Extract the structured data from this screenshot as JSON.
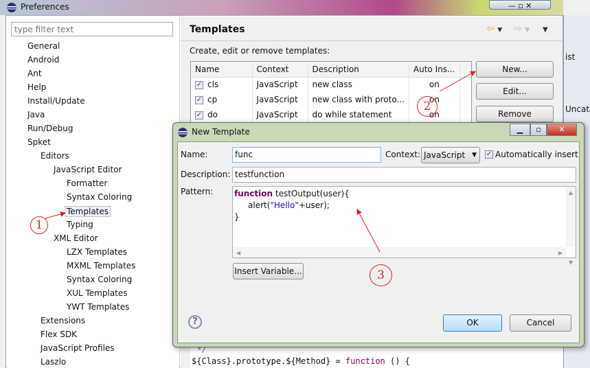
{
  "window": {
    "title": "Preferences"
  },
  "filter": {
    "placeholder": "type filter text"
  },
  "tree": [
    {
      "label": "General",
      "level": 1
    },
    {
      "label": "Android",
      "level": 1
    },
    {
      "label": "Ant",
      "level": 1
    },
    {
      "label": "Help",
      "level": 1
    },
    {
      "label": "Install/Update",
      "level": 1
    },
    {
      "label": "Java",
      "level": 1
    },
    {
      "label": "Run/Debug",
      "level": 1
    },
    {
      "label": "Spket",
      "level": 1
    },
    {
      "label": "Editors",
      "level": 2
    },
    {
      "label": "JavaScript Editor",
      "level": 3
    },
    {
      "label": "Formatter",
      "level": 4
    },
    {
      "label": "Syntax Coloring",
      "level": 4
    },
    {
      "label": "Templates",
      "level": 4,
      "selected": true
    },
    {
      "label": "Typing",
      "level": 4
    },
    {
      "label": "XML Editor",
      "level": 3
    },
    {
      "label": "LZX Templates",
      "level": 4
    },
    {
      "label": "MXML Templates",
      "level": 4
    },
    {
      "label": "Syntax Coloring",
      "level": 4
    },
    {
      "label": "XUL Templates",
      "level": 4
    },
    {
      "label": "YWT Templates",
      "level": 4
    },
    {
      "label": "Extensions",
      "level": 2
    },
    {
      "label": "Flex SDK",
      "level": 2
    },
    {
      "label": "JavaScript Profiles",
      "level": 2
    },
    {
      "label": "Laszlo",
      "level": 2
    }
  ],
  "page": {
    "title": "Templates",
    "description": "Create, edit or remove templates:",
    "columns": [
      "Name",
      "Context",
      "Description",
      "Auto Ins..."
    ],
    "rows": [
      {
        "checked": true,
        "name": "cls",
        "context": "JavaScript",
        "description": "new class",
        "auto": "on"
      },
      {
        "checked": true,
        "name": "cp",
        "context": "JavaScript",
        "description": "new class with proto...",
        "auto": "on"
      },
      {
        "checked": true,
        "name": "do",
        "context": "JavaScript",
        "description": "do while statement",
        "auto": "on"
      }
    ],
    "buttons": {
      "new": "New...",
      "edit": "Edit...",
      "remove": "Remove"
    },
    "code_line": "${Class}.prototype.${Method} = ",
    "code_kw": "function",
    "code_tail": " () {",
    "code_comment": "*/"
  },
  "background_window": {
    "tab": "ist",
    "tree_item": "Uncate"
  },
  "dialog": {
    "title": "New Template",
    "name_label": "Name:",
    "name_value": "func",
    "context_label": "Context:",
    "context_value": "JavaScript",
    "auto_insert_label": "Automatically insert",
    "auto_insert_checked": true,
    "description_label": "Description:",
    "description_value": "testfunction",
    "pattern_label": "Pattern:",
    "pattern": {
      "kw": "function",
      "l1": " testOutput(user){",
      "l2a": "alert(",
      "l2str": "\"Hello\"",
      "l2b": "+user);",
      "l3": "}"
    },
    "insert_variable": "Insert Variable...",
    "ok": "OK",
    "cancel": "Cancel"
  },
  "annotations": [
    "1",
    "2",
    "3"
  ],
  "colors": {
    "annotation": "#dd2222",
    "keyword": "#7f0055",
    "string": "#2a00ff"
  }
}
